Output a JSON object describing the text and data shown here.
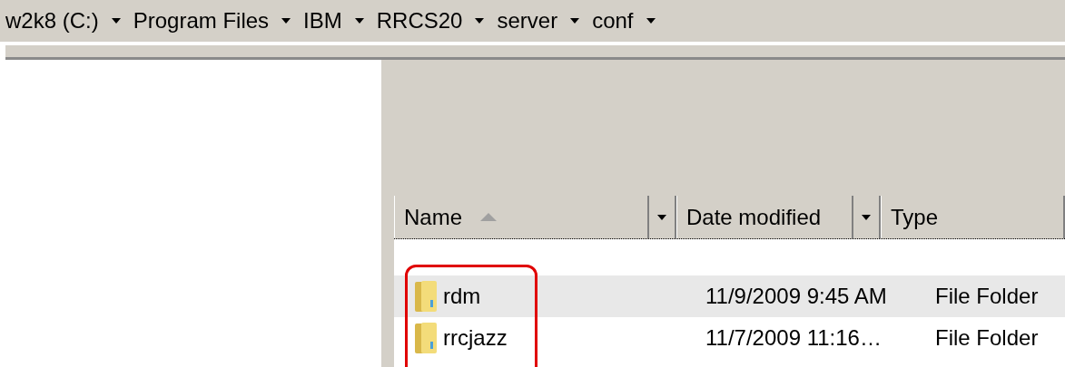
{
  "breadcrumb": [
    {
      "label": "w2k8 (C:)"
    },
    {
      "label": "Program Files"
    },
    {
      "label": "IBM"
    },
    {
      "label": "RRCS20"
    },
    {
      "label": "server"
    },
    {
      "label": "conf"
    }
  ],
  "columns": [
    {
      "label": "Name",
      "sorted": true
    },
    {
      "label": "Date modified",
      "sorted": false
    },
    {
      "label": "Type",
      "sorted": false
    }
  ],
  "rows": [
    {
      "name": "rdm",
      "date": "11/9/2009 9:45 AM",
      "type": "File Folder",
      "hovered": true
    },
    {
      "name": "rrcjazz",
      "date": "11/7/2009 11:16…",
      "type": "File Folder",
      "hovered": false
    }
  ],
  "annotation": {
    "outlined": true
  }
}
